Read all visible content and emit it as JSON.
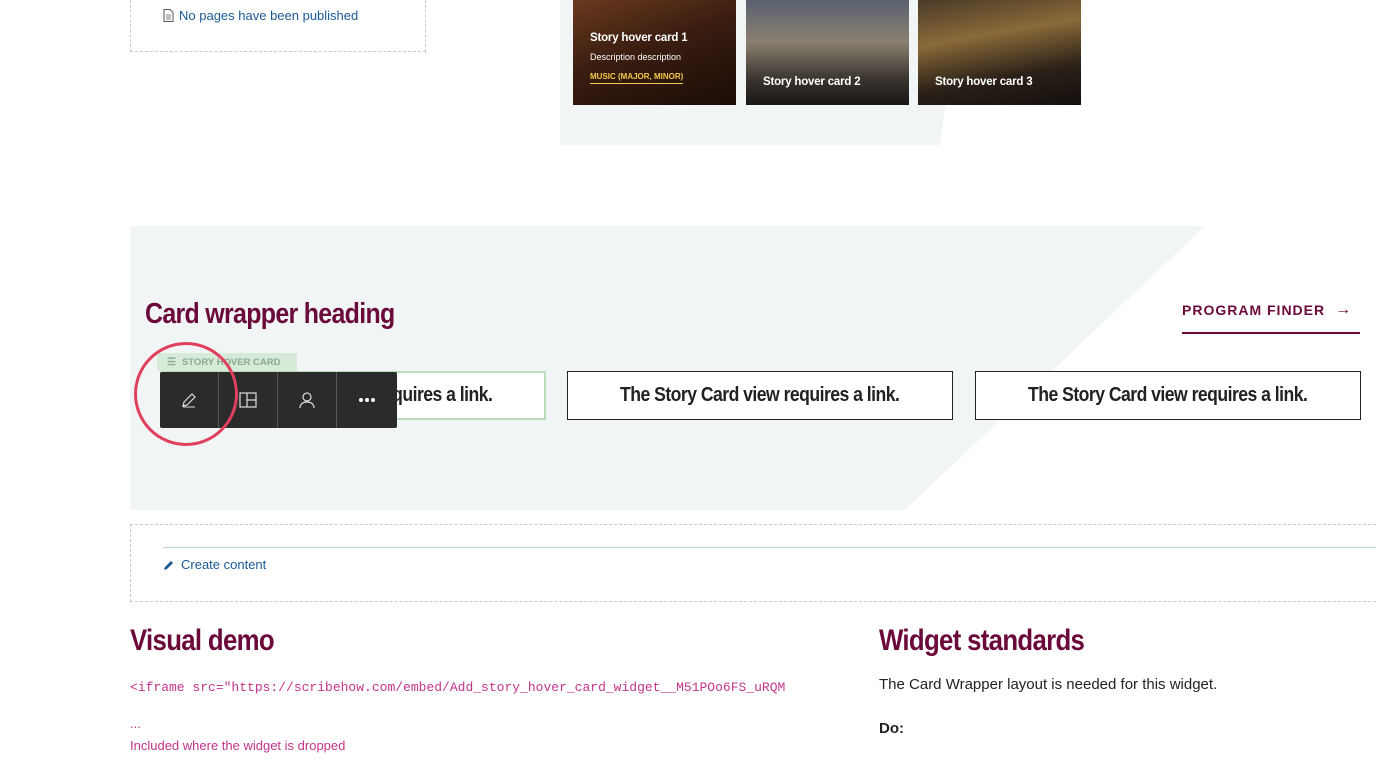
{
  "top": {
    "pages_link": "No pages have been published",
    "cards": [
      {
        "title": "Story hover card 1",
        "description": "Description description",
        "tag": "MUSIC (MAJOR, MINOR)"
      },
      {
        "title": "Story hover card 2"
      },
      {
        "title": "Story hover card 3"
      }
    ]
  },
  "wrapper": {
    "heading": "Card wrapper heading",
    "program_finder": "PROGRAM FINDER",
    "story_tag": "STORY HOVER CARD",
    "cards": [
      {
        "text": "The Story Card view requires a link."
      },
      {
        "text": "The Story Card view requires a link."
      },
      {
        "text": "The Story Card view requires a link."
      }
    ]
  },
  "create": {
    "label": "Create content"
  },
  "visual_demo": {
    "heading": "Visual demo",
    "code": "<iframe src=\"https://scribehow.com/embed/Add_story_hover_card_widget__M51POo6FS_uRQM",
    "ellipsis": "...",
    "note": "Included where the widget is dropped"
  },
  "widget_standards": {
    "heading": "Widget standards",
    "text": "The Card Wrapper layout is needed for this widget.",
    "do": "Do:"
  },
  "colors": {
    "brand": "#6b0a3a",
    "link": "#1a5a96",
    "code": "#c4348a",
    "highlight": "#e0405e"
  }
}
